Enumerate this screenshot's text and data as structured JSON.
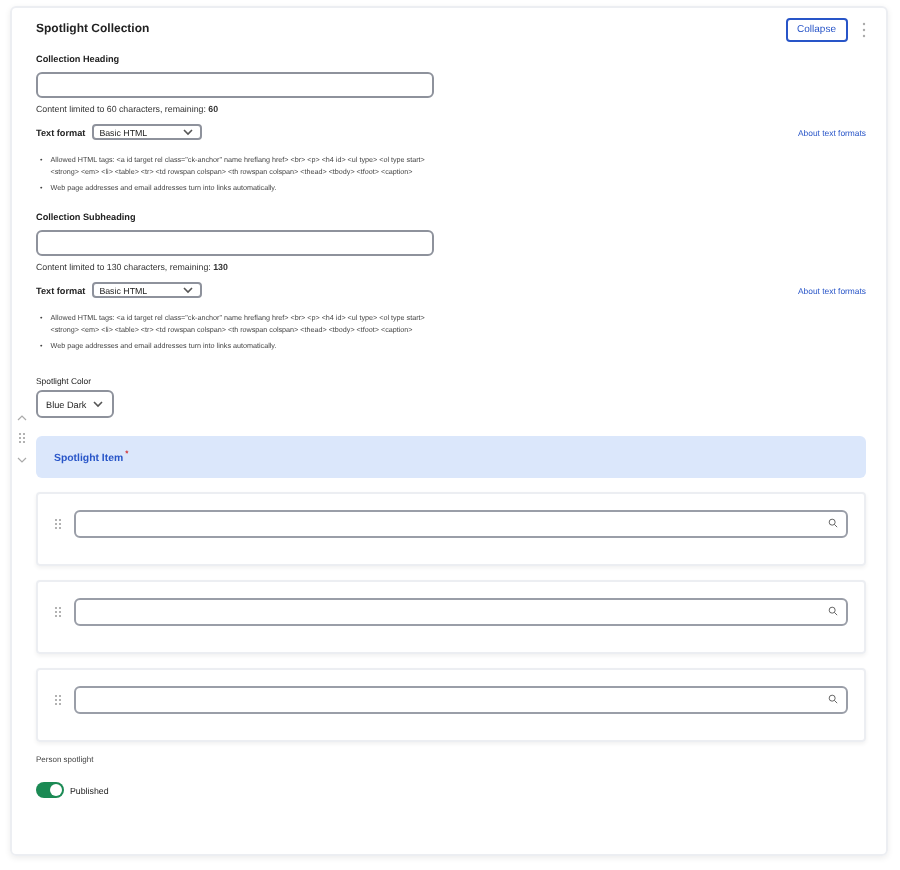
{
  "section": {
    "title": "Spotlight Collection",
    "collapse_button": "Collapse"
  },
  "text_fields": [
    {
      "label": "Collection Heading",
      "limit_note": "Content limited to 60 characters, remaining: **60**",
      "format_label": "Text format",
      "format_value": "Basic HTML",
      "format_link": "About text formats",
      "tips": [
        {
          "bullet": "•",
          "text": "Allowed HTML tags: <a id target rel class=\"ck-anchor\" name hreflang href> <br> <p> <h4 id> <ul type> <ol type start> <strong> <em> <li> <table> <tr> <td rowspan colspan> <th rowspan colspan> <thead> <tbody> <tfoot> <caption>"
        },
        {
          "bullet": "•",
          "text": "Web page addresses and email addresses turn into links automatically."
        }
      ]
    },
    {
      "label": "Collection Subheading",
      "limit_note": "Content limited to 130 characters, remaining: **130**",
      "format_label": "Text format",
      "format_value": "Basic HTML",
      "format_link": "About text formats",
      "tips": [
        {
          "bullet": "•",
          "text": "Allowed HTML tags: <a id target rel class=\"ck-anchor\" name hreflang href> <br> <p> <h4 id> <ul type> <ol type start> <strong> <em> <li> <table> <tr> <td rowspan colspan> <th rowspan colspan> <thead> <tbody> <tfoot> <caption>"
        },
        {
          "bullet": "•",
          "text": "Web page addresses and email addresses turn into links automatically."
        }
      ]
    }
  ],
  "color_field": {
    "label": "Spotlight Color",
    "value": "Blue Dark"
  },
  "spotlight_items": {
    "title": "Spotlight Item",
    "required_mark": "*",
    "rows": [
      {
        "kind": "autocomplete"
      },
      {
        "kind": "autocomplete"
      },
      {
        "kind": "autocomplete"
      }
    ]
  },
  "description": "Person spotlight",
  "published": {
    "label": "Published",
    "on": true
  }
}
